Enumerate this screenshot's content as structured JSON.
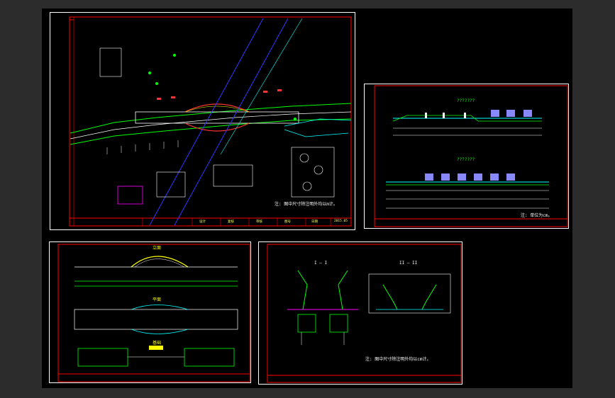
{
  "colors": {
    "background": "#2c2c2c",
    "modelspace": "#000000",
    "frame": "#ff0000",
    "line_white": "#ffffff",
    "line_green": "#00ff00",
    "line_cyan": "#00ffff",
    "line_blue": "#3333ff",
    "line_magenta": "#ff00ff",
    "line_yellow": "#ffff00",
    "line_red": "#ff3333"
  },
  "sheets": {
    "plan": {
      "note": "注: 图中尺寸除注明外均以m计。",
      "titleblock": [
        "设计",
        "复核",
        "审核",
        "图号",
        "日期",
        "2015.05"
      ]
    },
    "cross_section": {
      "title_top": "???????",
      "title_bottom": "???????",
      "note": "注: 单位为cm。"
    },
    "elevation": {
      "labels": [
        "立面",
        "平面",
        "基础"
      ]
    },
    "section_detail": {
      "label_left": "I — I",
      "label_right": "II — II",
      "note": "注: 图中尺寸除注明外均以cm计。"
    }
  }
}
